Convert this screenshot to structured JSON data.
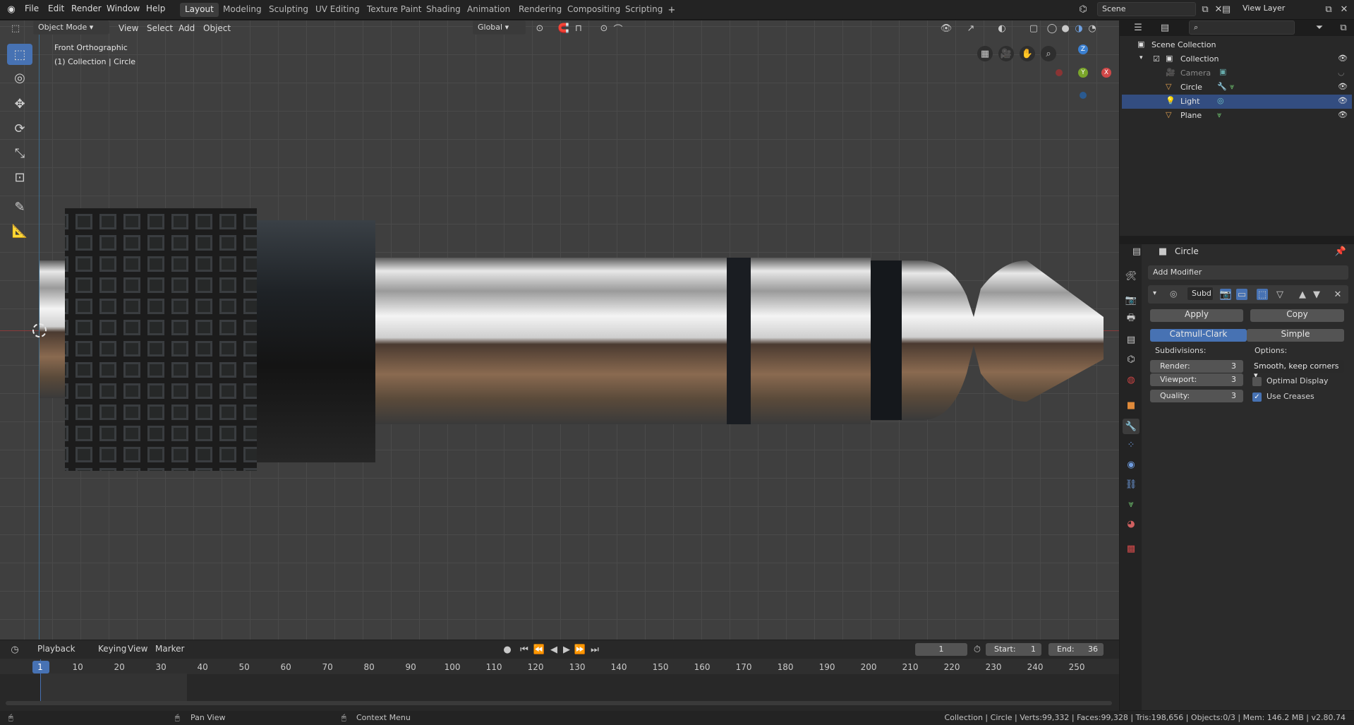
{
  "menus": [
    "File",
    "Edit",
    "Render",
    "Window",
    "Help"
  ],
  "workspaces": [
    "Layout",
    "Modeling",
    "Sculpting",
    "UV Editing",
    "Texture Paint",
    "Shading",
    "Animation",
    "Rendering",
    "Compositing",
    "Scripting"
  ],
  "active_workspace": "Layout",
  "scene": "Scene",
  "view_layer": "View Layer",
  "viewport_header": {
    "mode": "Object Mode",
    "menus": [
      "View",
      "Select",
      "Add",
      "Object"
    ],
    "orientation": "Global"
  },
  "viewport": {
    "view_name": "Front Orthographic",
    "collection_info": "(1) Collection | Circle",
    "gizmo": {
      "z": "Z",
      "y": "Y",
      "x": "X"
    }
  },
  "outliner": {
    "root": "Scene Collection",
    "collection": "Collection",
    "items": [
      {
        "name": "Camera"
      },
      {
        "name": "Circle"
      },
      {
        "name": "Light"
      },
      {
        "name": "Plane"
      }
    ]
  },
  "properties": {
    "object_name": "Circle",
    "add_modifier": "Add Modifier",
    "modifier_name": "Subd",
    "apply": "Apply",
    "copy": "Copy",
    "catmull": "Catmull-Clark",
    "simple": "Simple",
    "subdivisions_label": "Subdivisions:",
    "options_label": "Options:",
    "render_label": "Render:",
    "render_value": "3",
    "viewport_label": "Viewport:",
    "viewport_value": "3",
    "quality_label": "Quality:",
    "quality_value": "3",
    "uv_smooth": "Smooth, keep corners",
    "optimal_display": "Optimal Display",
    "use_creases": "Use Creases"
  },
  "timeline": {
    "menus": [
      "Playback",
      "Keying",
      "View",
      "Marker"
    ],
    "current_frame": "1",
    "start_label": "Start:",
    "start": "1",
    "end_label": "End:",
    "end": "36",
    "ticks": [
      "1",
      "10",
      "20",
      "30",
      "40",
      "50",
      "60",
      "70",
      "80",
      "90",
      "100",
      "110",
      "120",
      "130",
      "140",
      "150",
      "160",
      "170",
      "180",
      "190",
      "200",
      "210",
      "220",
      "230",
      "240",
      "250"
    ]
  },
  "status": {
    "pan": "Pan View",
    "context": "Context Menu",
    "info": "Collection | Circle | Verts:99,332 | Faces:99,328 | Tris:198,656 | Objects:0/3 | Mem: 146.2 MB | v2.80.74"
  },
  "colors": {
    "accent": "#4772b3",
    "viewport_bg": "#3f3f3f",
    "selected_row": "#334d80"
  }
}
